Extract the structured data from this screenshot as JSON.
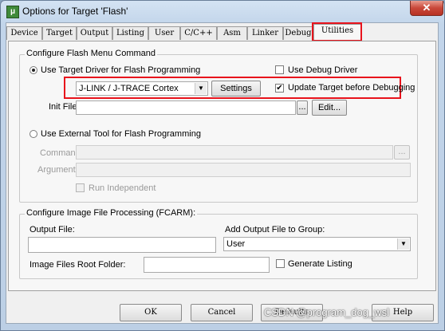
{
  "window": {
    "title": "Options for Target 'Flash'",
    "close_label": "✕",
    "app_icon": "μ"
  },
  "tabs": [
    "Device",
    "Target",
    "Output",
    "Listing",
    "User",
    "C/C++",
    "Asm",
    "Linker",
    "Debug",
    "Utilities"
  ],
  "active_tab": "Utilities",
  "flash_menu": {
    "group_label": "Configure Flash Menu Command",
    "use_target_driver_label": "Use Target Driver for Flash Programming",
    "use_debug_driver_label": "Use Debug Driver",
    "driver_selected": "J-LINK / J-TRACE Cortex",
    "settings_label": "Settings",
    "update_target_label": "Update Target before Debugging",
    "update_target_check": "✔",
    "init_file_label": "Init File:",
    "init_file_value": "",
    "browse_label": "...",
    "edit_label": "Edit...",
    "use_external_tool_label": "Use External Tool for Flash Programming",
    "command_label": "Command:",
    "command_value": "",
    "arguments_label": "Arguments:",
    "arguments_value": "",
    "run_independent_label": "Run Independent"
  },
  "image_processing": {
    "group_label": "Configure Image File Processing (FCARM):",
    "output_file_label": "Output File:",
    "output_file_value": "",
    "add_to_group_label": "Add Output File  to Group:",
    "group_selected": "User",
    "root_folder_label": "Image Files Root Folder:",
    "root_folder_value": "",
    "generate_listing_label": "Generate Listing"
  },
  "footer": {
    "ok": "OK",
    "cancel": "Cancel",
    "defaults": "Defaults",
    "help": "Help"
  },
  "watermark": "CSDN @program_dog_wsl",
  "colors": {
    "highlight": "#e8131c",
    "titlebar": "#c2d5ea",
    "dialog": "#f0f0f0"
  }
}
